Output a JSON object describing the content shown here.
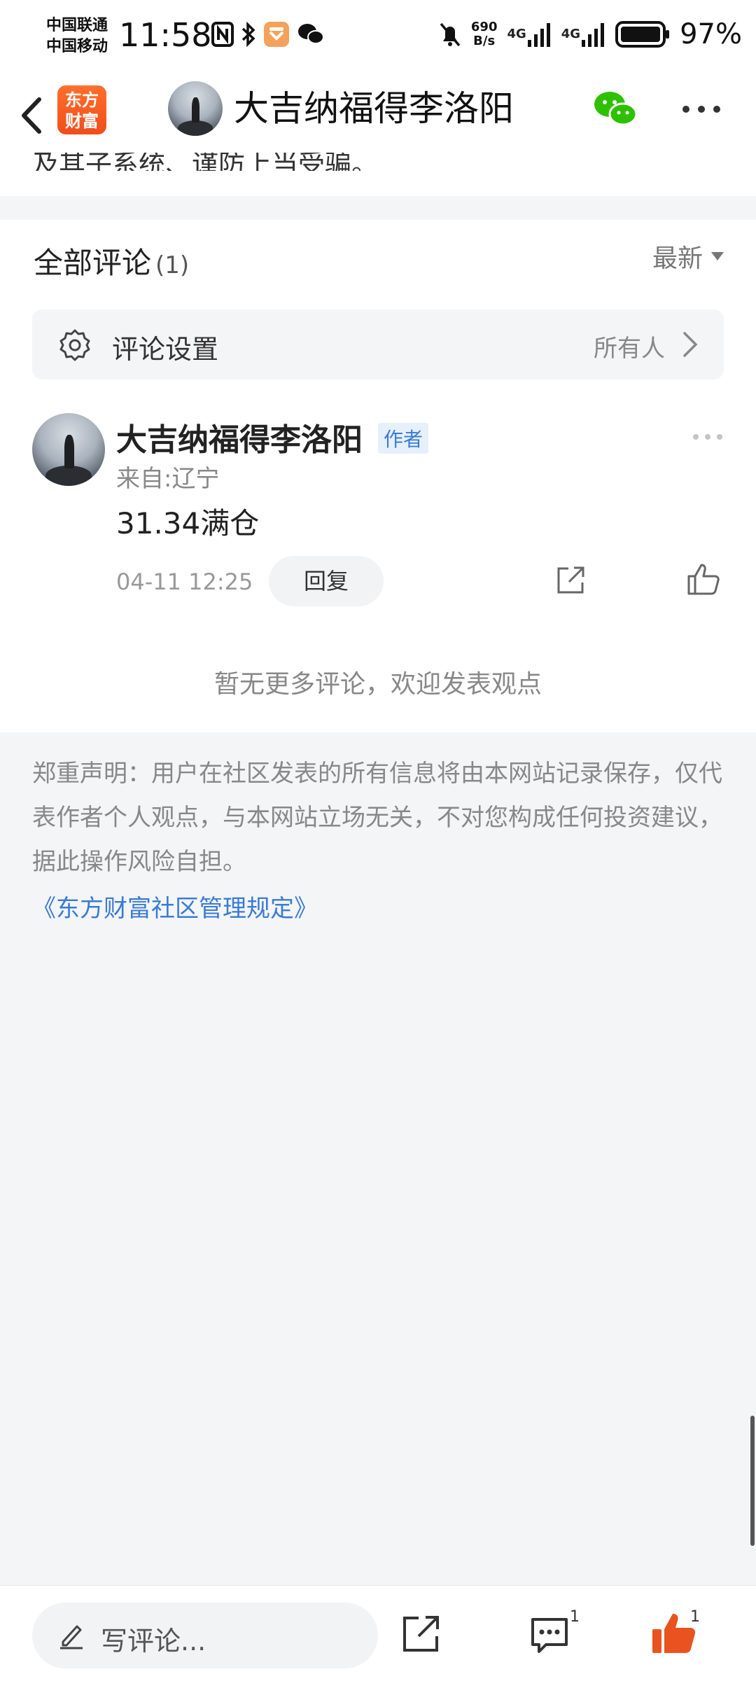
{
  "status_bar": {
    "carrier1": "中国联通",
    "carrier2": "中国移动",
    "time": "11:58",
    "net_speed_value": "690",
    "net_speed_unit": "B/s",
    "network1": "4G",
    "network2": "4G",
    "battery": "97%"
  },
  "nav": {
    "logo_line1": "东方",
    "logo_line2": "财富",
    "title": "大吉纳福得李洛阳"
  },
  "partial_text": "及其子系统、谨防上当受骗。",
  "comments_section": {
    "title": "全部评论",
    "count": "(1)",
    "sort_label": "最新",
    "settings_label": "评论设置",
    "settings_value": "所有人"
  },
  "comment": {
    "author": "大吉纳福得李洛阳",
    "author_badge": "作者",
    "location": "来自:辽宁",
    "body": "31.34满仓",
    "time": "04-11 12:25",
    "reply_label": "回复"
  },
  "no_more_text": "暂无更多评论，欢迎发表观点",
  "disclaimer": {
    "text": "郑重声明：用户在社区发表的所有信息将由本网站记录保存，仅代表作者个人观点，与本网站立场无关，不对您构成任何投资建议，据此操作风险自担。",
    "link": "《东方财富社区管理规定》"
  },
  "bottom_bar": {
    "placeholder": "写评论...",
    "comment_count": "1",
    "like_count": "1"
  },
  "colors": {
    "accent_blue": "#3a7bd5",
    "like_orange": "#e8531f",
    "wechat_green": "#2dc100"
  }
}
